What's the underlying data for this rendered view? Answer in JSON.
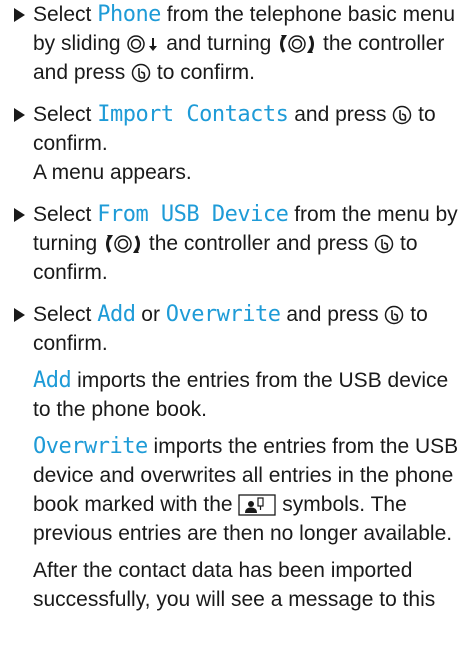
{
  "steps": [
    {
      "parts": [
        "Select ",
        "Phone",
        " from the telephone basic menu by sliding ",
        " and turning ",
        " the controller and press ",
        " to confirm."
      ]
    },
    {
      "parts": [
        "Select ",
        "Import Contacts",
        " and press ",
        " to confirm."
      ],
      "sub": "A menu appears."
    },
    {
      "parts": [
        "Select ",
        "From USB Device",
        " from the menu by turning ",
        " the controller and press ",
        " to confirm."
      ]
    },
    {
      "parts": [
        "Select ",
        "Add",
        " or ",
        "Overwrite",
        " and press ",
        " to confirm."
      ],
      "add_kw": "Add",
      "add_text": " imports the entries from the USB device to the phone book.",
      "overwrite_kw": "Overwrite",
      "overwrite_text_1": " imports the entries from the USB device and overwrites all entries in the phone book marked with the ",
      "overwrite_text_2": " symbols. The previous entries are then no longer available.",
      "after_text": "After the contact data has been imported successfully, you will see a message to this"
    }
  ],
  "icons": {
    "slide": "controller-slide-down-icon",
    "turn": "controller-turn-icon",
    "press": "controller-press-icon",
    "usb_entry": "usb-contact-entry-icon"
  },
  "colors": {
    "keyword": "#1e9bd7",
    "text": "#1a1a1a"
  }
}
